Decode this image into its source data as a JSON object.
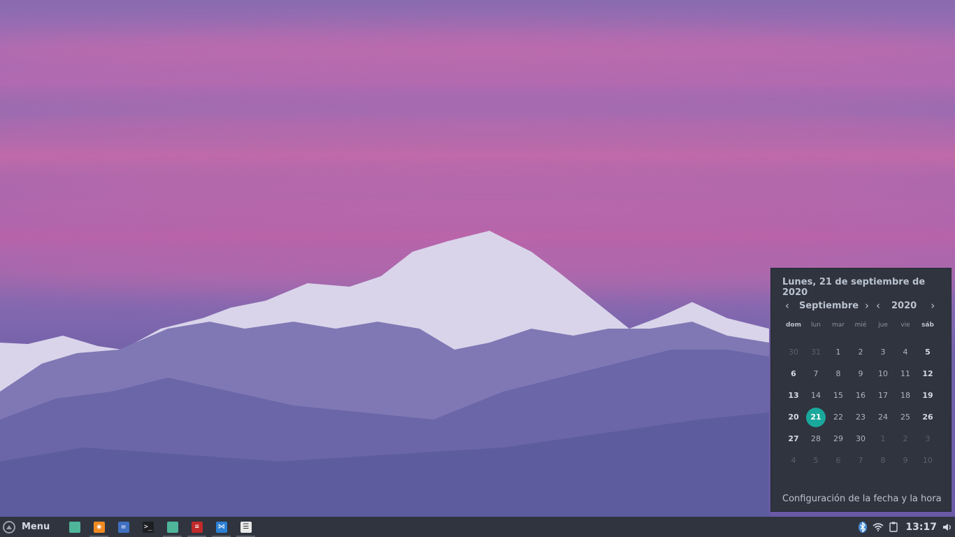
{
  "taskbar": {
    "menu_label": "Menu",
    "apps": [
      {
        "name": "files-icon",
        "color": "#4fb59a",
        "glyph": "",
        "running": false
      },
      {
        "name": "firefox-icon",
        "color": "#f08b22",
        "glyph": "◉",
        "running": true
      },
      {
        "name": "mail-icon",
        "color": "#3f6fc0",
        "glyph": "✉",
        "running": false
      },
      {
        "name": "terminal-icon",
        "color": "#1d1f23",
        "glyph": ">_",
        "running": false
      },
      {
        "name": "folder-icon",
        "color": "#4fb59a",
        "glyph": "",
        "running": true
      },
      {
        "name": "app-red-icon",
        "color": "#c02a2a",
        "glyph": "≡",
        "running": true
      },
      {
        "name": "vscode-icon",
        "color": "#2b7fd4",
        "glyph": "⋈",
        "running": true
      },
      {
        "name": "settings-icon",
        "color": "#e8e8e8",
        "glyph": "☰",
        "running": true
      }
    ],
    "clock": "13:17"
  },
  "calendar": {
    "full_date": "Lunes, 21 de septiembre de 2020",
    "month": "Septiembre",
    "year": "2020",
    "weekdays": [
      "dom",
      "lun",
      "mar",
      "mié",
      "jue",
      "vie",
      "sáb"
    ],
    "weeks": [
      [
        "30",
        "31",
        "1",
        "2",
        "3",
        "4",
        "5"
      ],
      [
        "6",
        "7",
        "8",
        "9",
        "10",
        "11",
        "12"
      ],
      [
        "13",
        "14",
        "15",
        "16",
        "17",
        "18",
        "19"
      ],
      [
        "20",
        "21",
        "22",
        "23",
        "24",
        "25",
        "26"
      ],
      [
        "27",
        "28",
        "29",
        "30",
        "1",
        "2",
        "3"
      ],
      [
        "4",
        "5",
        "6",
        "7",
        "8",
        "9",
        "10"
      ]
    ],
    "today": "21",
    "footer": "Configuración de la fecha y la hora",
    "accent_color": "#1aa89c"
  }
}
